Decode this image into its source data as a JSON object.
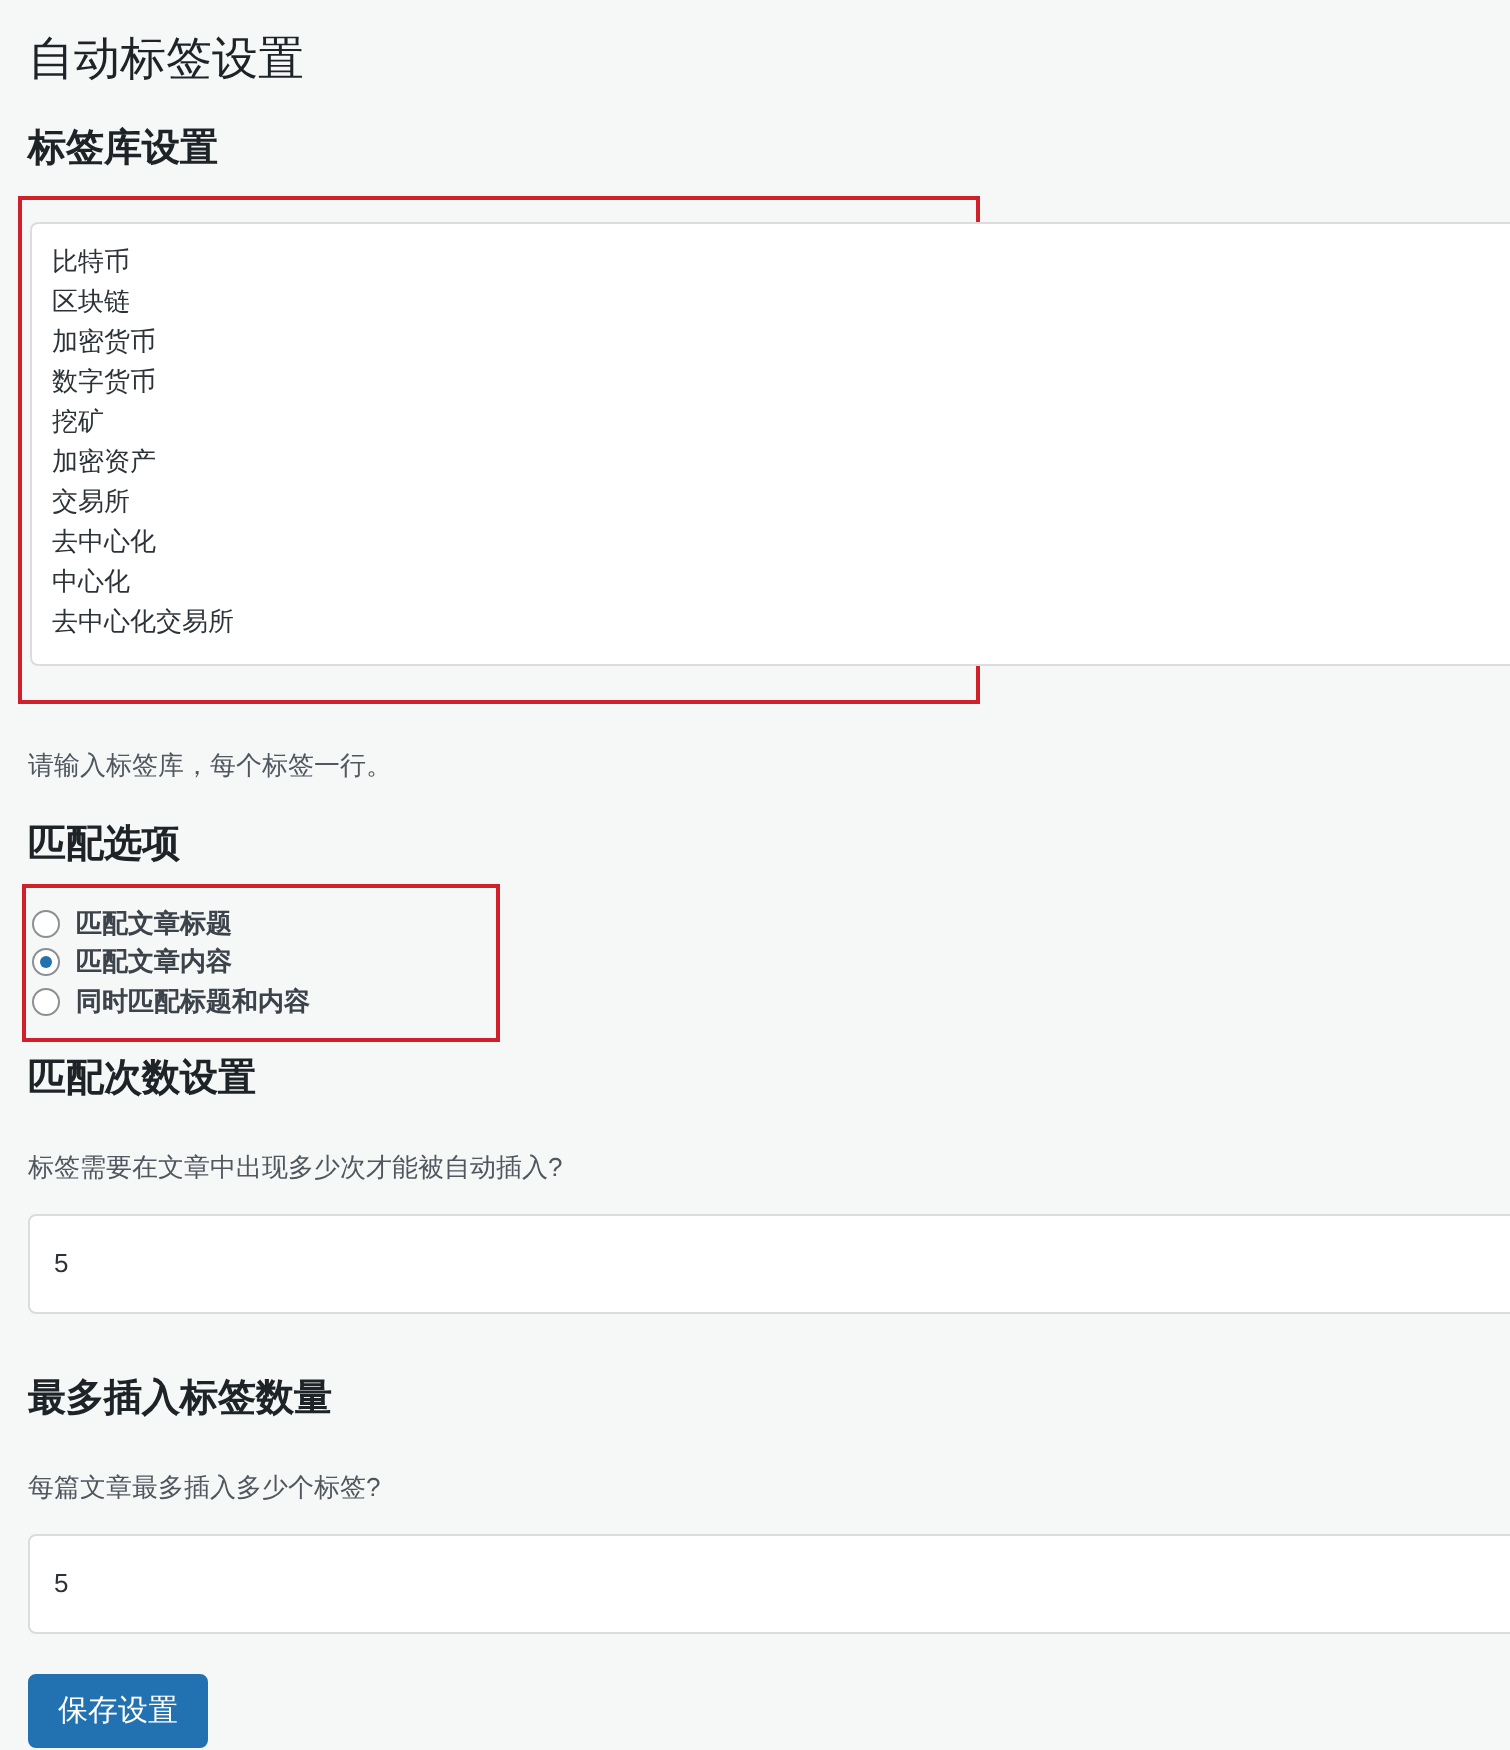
{
  "page_title": "自动标签设置",
  "tag_library": {
    "heading": "标签库设置",
    "lines": [
      "比特币",
      "区块链",
      "加密货币",
      "数字货币",
      "挖矿",
      "加密资产",
      "交易所",
      "去中心化",
      "中心化",
      "去中心化交易所"
    ],
    "help": "请输入标签库，每个标签一行。"
  },
  "match_options": {
    "heading": "匹配选项",
    "options": [
      {
        "label": "匹配文章标题",
        "selected": false
      },
      {
        "label": "匹配文章内容",
        "selected": true
      },
      {
        "label": "同时匹配标题和内容",
        "selected": false
      }
    ]
  },
  "match_count": {
    "heading": "匹配次数设置",
    "help": "标签需要在文章中出现多少次才能被自动插入?",
    "value": "5"
  },
  "max_tags": {
    "heading": "最多插入标签数量",
    "help": "每篇文章最多插入多少个标签?",
    "value": "5"
  },
  "save_button": "保存设置"
}
